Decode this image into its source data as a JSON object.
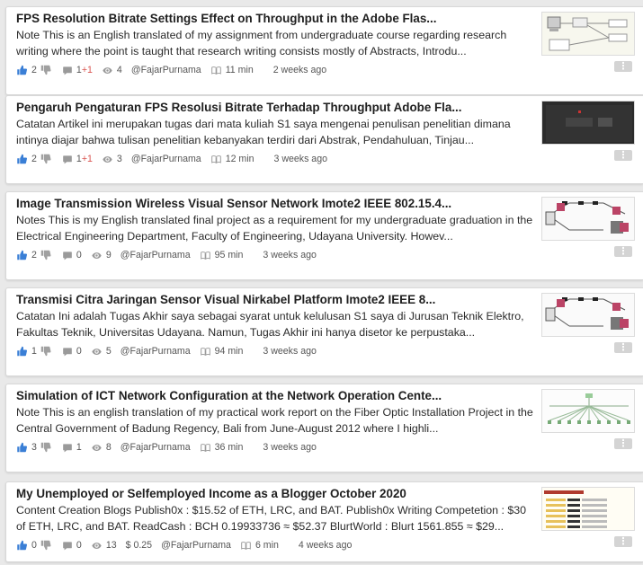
{
  "colors": {
    "page_background": "#e9e9e9",
    "card_background": "#ffffff",
    "upvote_blue": "#3a7fd6",
    "icon_grey": "#9a9a9a",
    "downvote_negative": "#d9534f"
  },
  "icons": {
    "upvote": "thumbs-up-icon",
    "downvote": "thumbs-down-icon",
    "comments": "comment-icon",
    "views": "eye-icon",
    "author": "user-icon",
    "read_time": "book-icon",
    "earnings": "dollar-icon",
    "menu": "vertical-ellipsis-icon"
  },
  "posts": [
    {
      "title": "FPS Resolution Bitrate Settings Effect on Throughput in the Adobe Flas...",
      "excerpt": "Note This is an English translated of my assignment from undergraduate course regarding research writing where the point is taught that research writing consists mostly of Abstracts, Introdu...",
      "upvotes": "2",
      "comments": "1",
      "downvote_delta": "+1",
      "views": "4",
      "earnings": "",
      "author": "@FajarPurnama",
      "read_time": "11 min",
      "posted": "2 weeks ago",
      "thumbnail": "network-diagram"
    },
    {
      "title": "Pengaruh Pengaturan FPS Resolusi Bitrate Terhadap Throughput Adobe Fla...",
      "excerpt": "Catatan Artikel ini merupakan tugas dari mata kuliah S1 saya mengenai penulisan penelitian dimana intinya diajar bahwa tulisan penelitian kebanyakan terdiri dari Abstrak, Pendahuluan, Tinjau...",
      "upvotes": "2",
      "comments": "1",
      "downvote_delta": "+1",
      "views": "3",
      "earnings": "",
      "author": "@FajarPurnama",
      "read_time": "12 min",
      "posted": "3 weeks ago",
      "thumbnail": "dark-screen"
    },
    {
      "title": "Image Transmission Wireless Visual Sensor Network Imote2 IEEE 802.15.4...",
      "excerpt": "Notes This is my English translated final project as a requirement for my undergraduate graduation in the Electrical Engineering Department, Faculty of Engineering, Udayana University. Howev...",
      "upvotes": "2",
      "comments": "0",
      "downvote_delta": "",
      "views": "9",
      "earnings": "",
      "author": "@FajarPurnama",
      "read_time": "95 min",
      "posted": "3 weeks ago",
      "thumbnail": "sensor-network"
    },
    {
      "title": "Transmisi Citra Jaringan Sensor Visual Nirkabel Platform Imote2 IEEE 8...",
      "excerpt": "Catatan Ini adalah Tugas Akhir saya sebagai syarat untuk kelulusan S1 saya di Jurusan Teknik Elektro, Fakultas Teknik, Universitas Udayana. Namun, Tugas Akhir ini hanya disetor ke perpustaka...",
      "upvotes": "1",
      "comments": "0",
      "downvote_delta": "",
      "views": "5",
      "earnings": "",
      "author": "@FajarPurnama",
      "read_time": "94 min",
      "posted": "3 weeks ago",
      "thumbnail": "sensor-network"
    },
    {
      "title": "Simulation of ICT Network Configuration at the Network Operation Cente...",
      "excerpt": "Note This is an english translation of my practical work report on the Fiber Optic Installation Project in the Central Government of Badung Regency, Bali from June-August 2012 where I highli...",
      "upvotes": "3",
      "comments": "1",
      "downvote_delta": "",
      "views": "8",
      "earnings": "",
      "author": "@FajarPurnama",
      "read_time": "36 min",
      "posted": "3 weeks ago",
      "thumbnail": "tree-topology"
    },
    {
      "title": "My Unemployed or Selfemployed Income as a Blogger October 2020",
      "excerpt": "Content Creation Blogs Publish0x : $15.52 of ETH, LRC, and BAT. Publish0x Writing Competetion : $30 of ETH, LRC, and BAT. ReadCash : BCH 0.19933736 ≈ $52.37 BlurtWorld : Blurt 1561.855 ≈ $29...",
      "upvotes": "0",
      "comments": "0",
      "downvote_delta": "",
      "views": "13",
      "earnings": "$ 0.25",
      "author": "@FajarPurnama",
      "read_time": "6 min",
      "posted": "4 weeks ago",
      "thumbnail": "income-table"
    }
  ]
}
